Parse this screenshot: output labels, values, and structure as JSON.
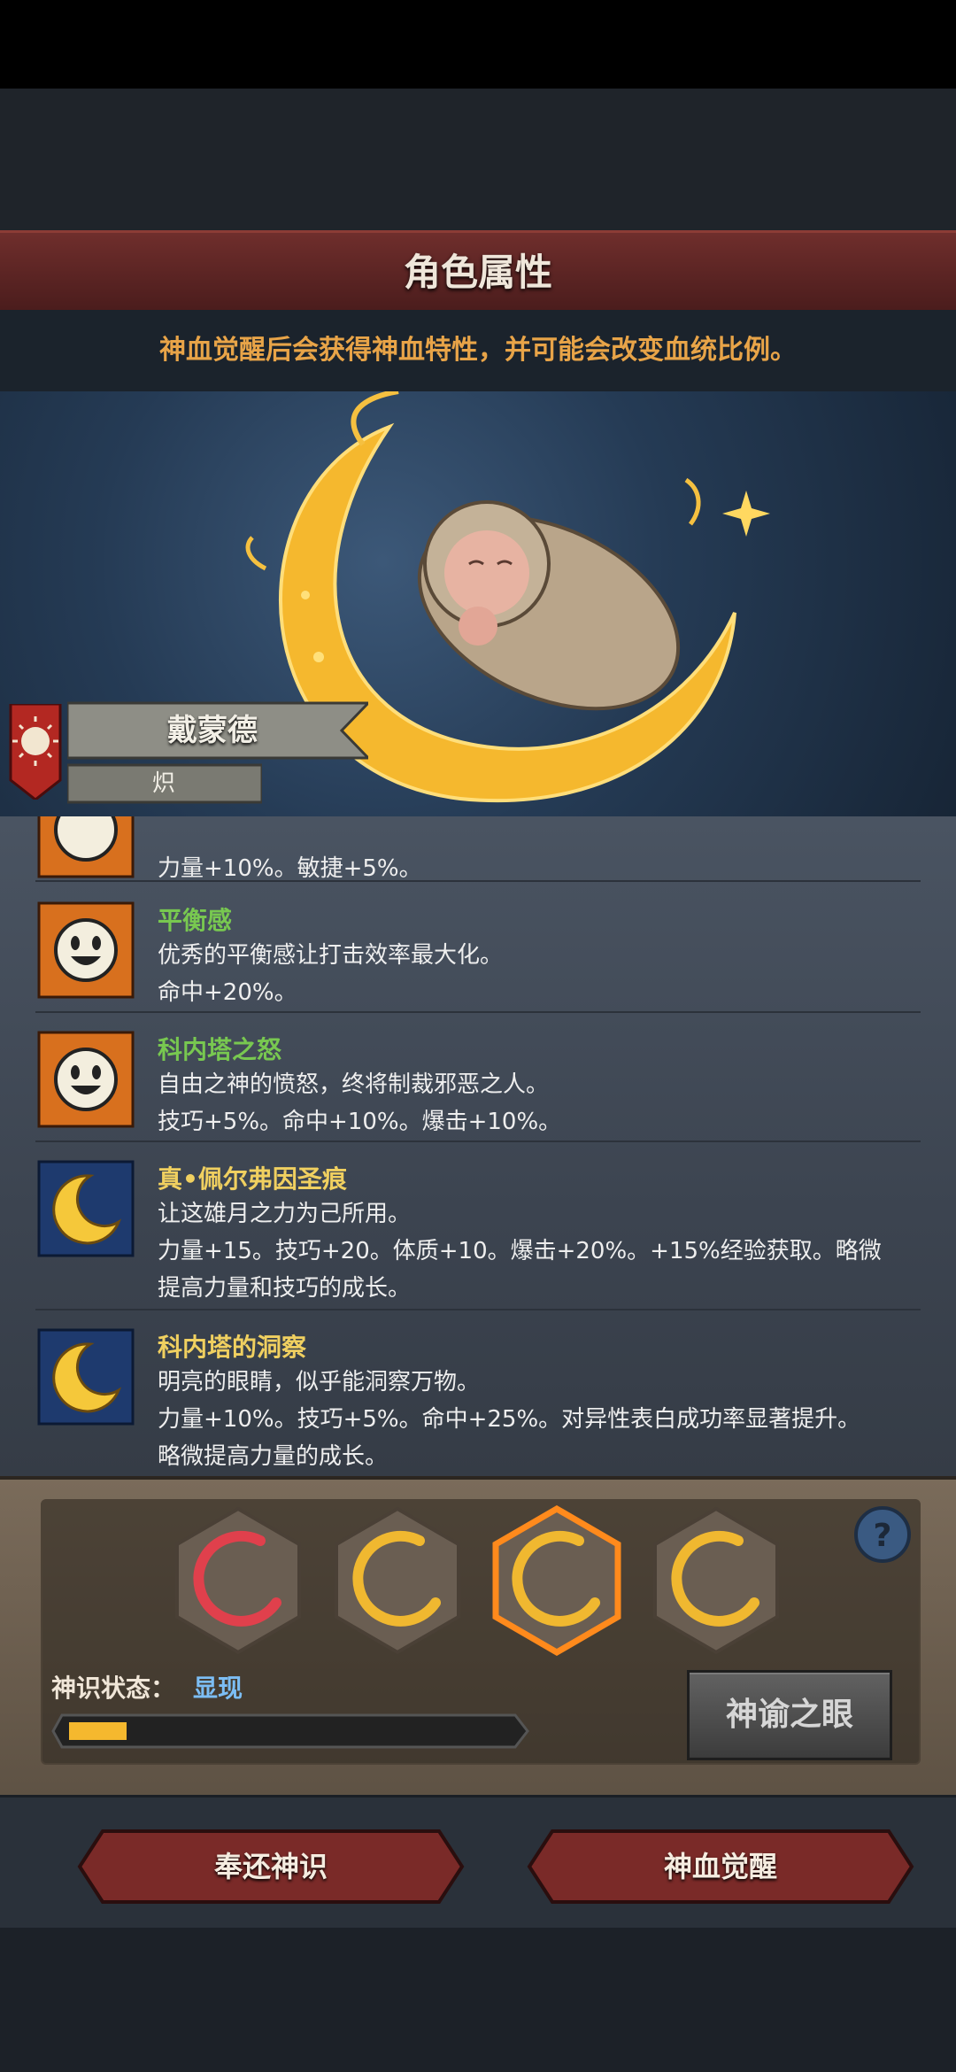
{
  "header": {
    "title": "角色属性",
    "subtitle": "神血觉醒后会获得神血特性，并可能会改变血统比例。"
  },
  "character": {
    "name": "戴蒙德",
    "sub": "炽"
  },
  "traits": [
    {
      "name": "",
      "line1": "",
      "line2": "力量+10%。敏捷+5%。",
      "icon": "sun-face-icon",
      "name_color": "#78c850"
    },
    {
      "name": "平衡感",
      "line1": "优秀的平衡感让打击效率最大化。",
      "line2": "命中+20%。",
      "icon": "sun-face-icon",
      "name_color": "#78c850"
    },
    {
      "name": "科内塔之怒",
      "line1": "自由之神的愤怒，终将制裁邪恶之人。",
      "line2": "技巧+5%。命中+10%。爆击+10%。",
      "icon": "sun-face-icon",
      "name_color": "#78c850"
    },
    {
      "name": "真•佩尔弗因圣痕",
      "line1": "让这雄月之力为己所用。",
      "line2": "力量+15。技巧+20。体质+10。爆击+20%。+15%经验获取。略微",
      "line3": "提高力量和技巧的成长。",
      "icon": "crescent-moon-icon",
      "name_color": "#f0d060"
    },
    {
      "name": "科内塔的洞察",
      "line1": "明亮的眼睛，似乎能洞察万物。",
      "line2": "力量+10%。技巧+5%。命中+25%。对异性表白成功率显著提升。",
      "line3": "略微提高力量的成长。",
      "icon": "crescent-moon-icon",
      "name_color": "#f0d060"
    }
  ],
  "slots": [
    {
      "icon": "red-crescent-icon",
      "color": "#e0404c"
    },
    {
      "icon": "gold-crescent-icon",
      "color": "#f0b830"
    },
    {
      "icon": "gold-crescent-icon",
      "color": "#f0b830",
      "selected": true
    },
    {
      "icon": "gold-crescent-icon",
      "color": "#f0b830"
    }
  ],
  "status": {
    "label": "神识状态：",
    "value": "显现",
    "progress": 0.13
  },
  "buttons": {
    "oracle": "神谕之眼",
    "return": "奉还神识",
    "awaken": "神血觉醒"
  },
  "colors": {
    "accent_gold": "#f5b82e",
    "title_red": "#6f2e2c",
    "status_blue": "#7cbef5"
  }
}
